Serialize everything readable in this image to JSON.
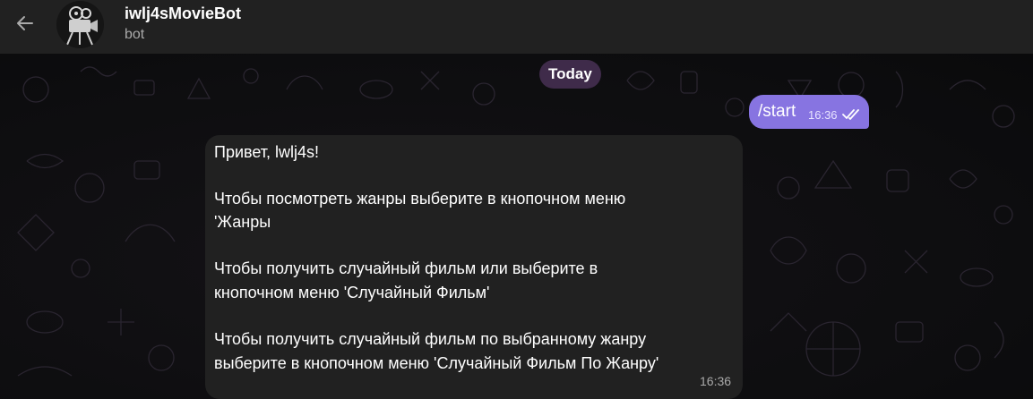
{
  "header": {
    "title": "iwlj4sMovieBot",
    "subtitle": "bot",
    "back_icon": "arrow-left-icon",
    "avatar_icon": "film-camera-avatar"
  },
  "date_separator": "Today",
  "messages": {
    "outgoing": {
      "text": "/start",
      "time": "16:36",
      "status_icon": "double-check-icon",
      "color": "#8774e1"
    },
    "incoming": {
      "lines": [
        "Привет, lwlj4s!",
        "Чтобы посмотреть жанры выберите в кнопочном меню",
        "'Жанры",
        "Чтобы получить случайный фильм или выберите в",
        "кнопочном меню 'Случайный Фильм'",
        "Чтобы получить случайный фильм по выбранному жанру",
        "выберите в кнопочном меню 'Случайный Фильм По Жанру'"
      ],
      "time": "16:36",
      "color": "#212121"
    }
  },
  "colors": {
    "header_bg": "#212121",
    "date_pill_bg": "#3f2b4a",
    "accent": "#8774e1"
  }
}
